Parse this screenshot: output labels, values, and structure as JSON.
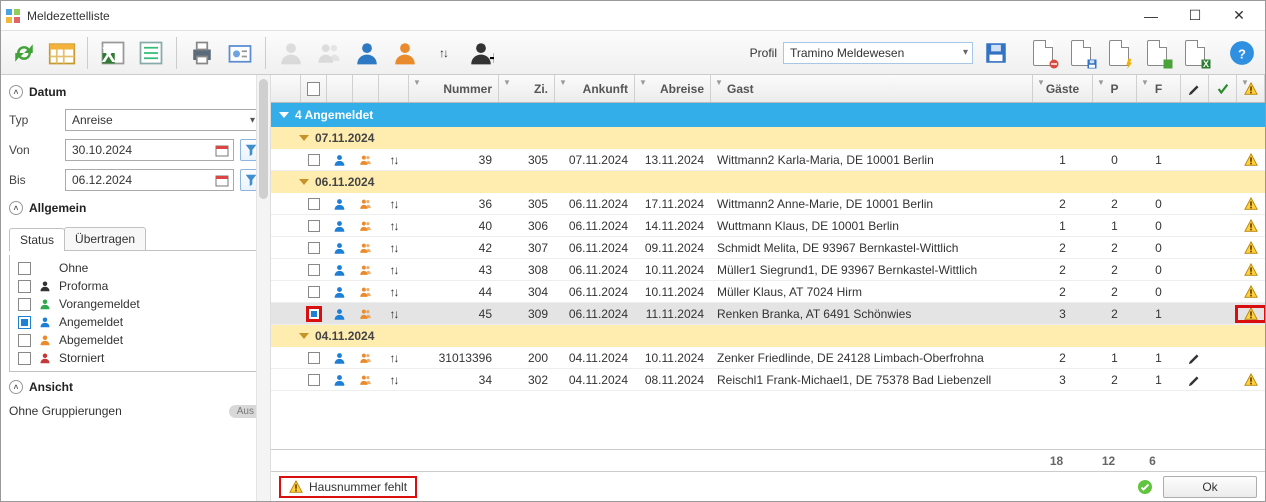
{
  "window": {
    "title": "Meldezettelliste"
  },
  "profile": {
    "label": "Profil",
    "value": "Tramino Meldewesen"
  },
  "sidebar": {
    "datum": {
      "title": "Datum",
      "typ_label": "Typ",
      "typ_value": "Anreise",
      "von_label": "Von",
      "von_value": "30.10.2024",
      "bis_label": "Bis",
      "bis_value": "06.12.2024"
    },
    "allgemein": {
      "title": "Allgemein"
    },
    "tabs": {
      "status": "Status",
      "uebertragen": "Übertragen"
    },
    "statuses": [
      {
        "label": "Ohne",
        "color": "#ffffff",
        "checked": false
      },
      {
        "label": "Proforma",
        "color": "#333333",
        "checked": false
      },
      {
        "label": "Vorangemeldet",
        "color": "#2fa84f",
        "checked": false
      },
      {
        "label": "Angemeldet",
        "color": "#1e7fd6",
        "checked": true
      },
      {
        "label": "Abgemeldet",
        "color": "#e98b2c",
        "checked": false
      },
      {
        "label": "Storniert",
        "color": "#c33a3a",
        "checked": false
      }
    ],
    "ansicht": {
      "title": "Ansicht",
      "group_label": "Ohne Gruppierungen",
      "toggle": "Aus"
    }
  },
  "grid": {
    "headers": {
      "nummer": "Nummer",
      "zi": "Zi.",
      "ankunft": "Ankunft",
      "abreise": "Abreise",
      "gast": "Gast",
      "gaeste": "Gäste",
      "p": "P",
      "f": "F"
    },
    "group_top": "4 Angemeldet",
    "groups": [
      {
        "date": "07.11.2024",
        "rows": [
          {
            "num": "39",
            "zi": "305",
            "an": "07.11.2024",
            "ab": "13.11.2024",
            "gast": "Wittmann2 Karla-Maria, DE 10001 Berlin",
            "g": "1",
            "p": "0",
            "f": "1",
            "warn": true,
            "edit": false,
            "sel": false
          }
        ]
      },
      {
        "date": "06.11.2024",
        "rows": [
          {
            "num": "36",
            "zi": "305",
            "an": "06.11.2024",
            "ab": "17.11.2024",
            "gast": "Wittmann2 Anne-Marie, DE 10001 Berlin",
            "g": "2",
            "p": "2",
            "f": "0",
            "warn": true,
            "edit": false,
            "sel": false
          },
          {
            "num": "40",
            "zi": "306",
            "an": "06.11.2024",
            "ab": "14.11.2024",
            "gast": "Wuttmann Klaus, DE 10001 Berlin",
            "g": "1",
            "p": "1",
            "f": "0",
            "warn": true,
            "edit": false,
            "sel": false
          },
          {
            "num": "42",
            "zi": "307",
            "an": "06.11.2024",
            "ab": "09.11.2024",
            "gast": "Schmidt Melita, DE 93967 Bernkastel-Wittlich",
            "g": "2",
            "p": "2",
            "f": "0",
            "warn": true,
            "edit": false,
            "sel": false
          },
          {
            "num": "43",
            "zi": "308",
            "an": "06.11.2024",
            "ab": "10.11.2024",
            "gast": "Müller1 Siegrund1, DE 93967 Bernkastel-Wittlich",
            "g": "2",
            "p": "2",
            "f": "0",
            "warn": true,
            "edit": false,
            "sel": false
          },
          {
            "num": "44",
            "zi": "304",
            "an": "06.11.2024",
            "ab": "10.11.2024",
            "gast": "Müller Klaus, AT 7024 Hirm",
            "g": "2",
            "p": "2",
            "f": "0",
            "warn": true,
            "edit": false,
            "sel": false
          },
          {
            "num": "45",
            "zi": "309",
            "an": "06.11.2024",
            "ab": "11.11.2024",
            "gast": "Renken Branka, AT 6491 Schönwies",
            "g": "3",
            "p": "2",
            "f": "1",
            "warn": true,
            "edit": false,
            "sel": true,
            "warn_hl": true
          }
        ]
      },
      {
        "date": "04.11.2024",
        "rows": [
          {
            "num": "31013396",
            "zi": "200",
            "an": "04.11.2024",
            "ab": "10.11.2024",
            "gast": "Zenker Friedlinde, DE 24128 Limbach-Oberfrohna",
            "g": "2",
            "p": "1",
            "f": "1",
            "warn": false,
            "edit": true,
            "sel": false
          },
          {
            "num": "34",
            "zi": "302",
            "an": "04.11.2024",
            "ab": "08.11.2024",
            "gast": "Reischl1 Frank-Michael1, DE 75378 Bad Liebenzell",
            "g": "3",
            "p": "2",
            "f": "1",
            "warn": true,
            "edit": true,
            "sel": false
          }
        ]
      }
    ],
    "footer": {
      "g": "18",
      "p": "12",
      "f": "6"
    }
  },
  "statusbar": {
    "msg": "Hausnummer fehlt",
    "ok": "Ok"
  }
}
